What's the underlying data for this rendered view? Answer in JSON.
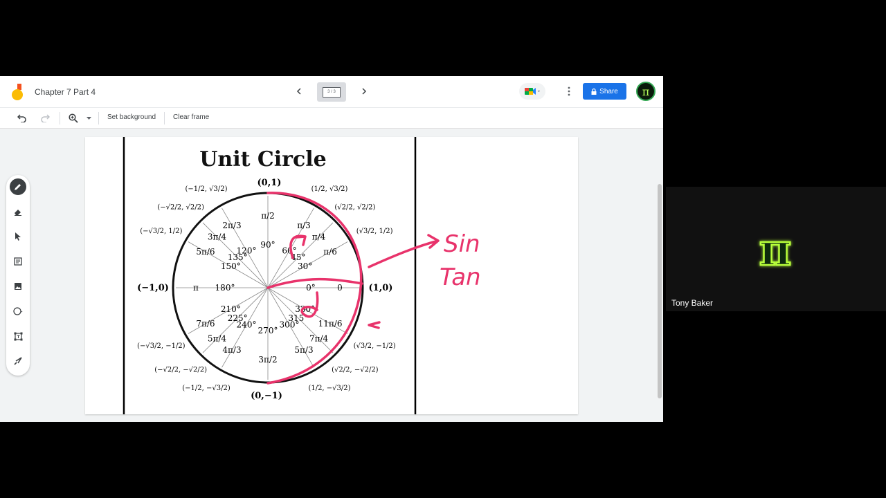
{
  "document": {
    "title": "Chapter 7 Part 4"
  },
  "frame_nav": {
    "indicator": "3 / 3"
  },
  "header": {
    "share_label": "Share"
  },
  "toolbar": {
    "set_background": "Set background",
    "clear_frame": "Clear frame"
  },
  "unit_circle": {
    "title": "Unit Circle",
    "axis_points": {
      "top": "(0,1)",
      "left": "(−1,0)",
      "right": "(1,0)",
      "bottom": "(0,−1)"
    },
    "degrees": [
      "0°",
      "30°",
      "45°",
      "60°",
      "90°",
      "120°",
      "135°",
      "150°",
      "180°",
      "210°",
      "225°",
      "240°",
      "270°",
      "300°",
      "315°",
      "330°"
    ],
    "radians": [
      "0",
      "π/6",
      "π/4",
      "π/3",
      "π/2",
      "2π/3",
      "3π/4",
      "5π/6",
      "π",
      "7π/6",
      "5π/4",
      "4π/3",
      "3π/2",
      "5π/3",
      "7π/4",
      "11π/6"
    ],
    "coords": [
      "(√3/2, 1/2)",
      "(√2/2, √2/2)",
      "(1/2, √3/2)",
      "(−1/2, √3/2)",
      "(−√2/2, √2/2)",
      "(−√3/2, 1/2)",
      "(−√3/2, −1/2)",
      "(−√2/2, −√2/2)",
      "(−1/2, −√3/2)",
      "(1/2, −√3/2)",
      "(√2/2, −√2/2)",
      "(√3/2, −1/2)"
    ]
  },
  "annotations": {
    "line1": "Sin",
    "line2": "Tan"
  },
  "participant": {
    "name": "Tony Baker",
    "logo": "π"
  },
  "colors": {
    "pen": "#e8336b",
    "accent": "#1a73e8"
  }
}
